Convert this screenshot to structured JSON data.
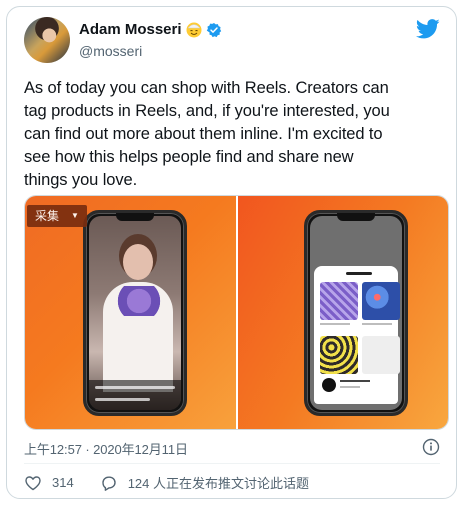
{
  "author": {
    "name": "Adam Mosseri",
    "handle": "@mosseri",
    "emoji": "smiling-face-emoji",
    "verified_icon": "verified-badge-icon",
    "avatar": "profile-photo"
  },
  "platform_icon": "twitter-bird-icon",
  "tweet": {
    "text_lines": [
      "As of today you can shop with Reels. Creators can",
      "tag products in Reels, and, if you're interested, you",
      "can find out more about them inline. I'm excited to",
      "see how this helps people find and share new",
      "things you love."
    ]
  },
  "media": {
    "overlay_button": "采集",
    "overlay_caret": "▼",
    "panels": [
      "reel-video-phone",
      "in-this-reel-shopping-sheet-phone"
    ]
  },
  "meta": {
    "timestamp": "上午12:57 · 2020年12月11日",
    "info_icon": "info-icon"
  },
  "actions": {
    "like_count": "314",
    "reply_text": "124 人正在发布推文讨论此话题"
  },
  "colors": {
    "brand_blue": "#1d9bf0",
    "text_primary": "#0f1419",
    "text_secondary": "#536471",
    "border": "#cfd9de",
    "media_orange": "#f47a22"
  }
}
